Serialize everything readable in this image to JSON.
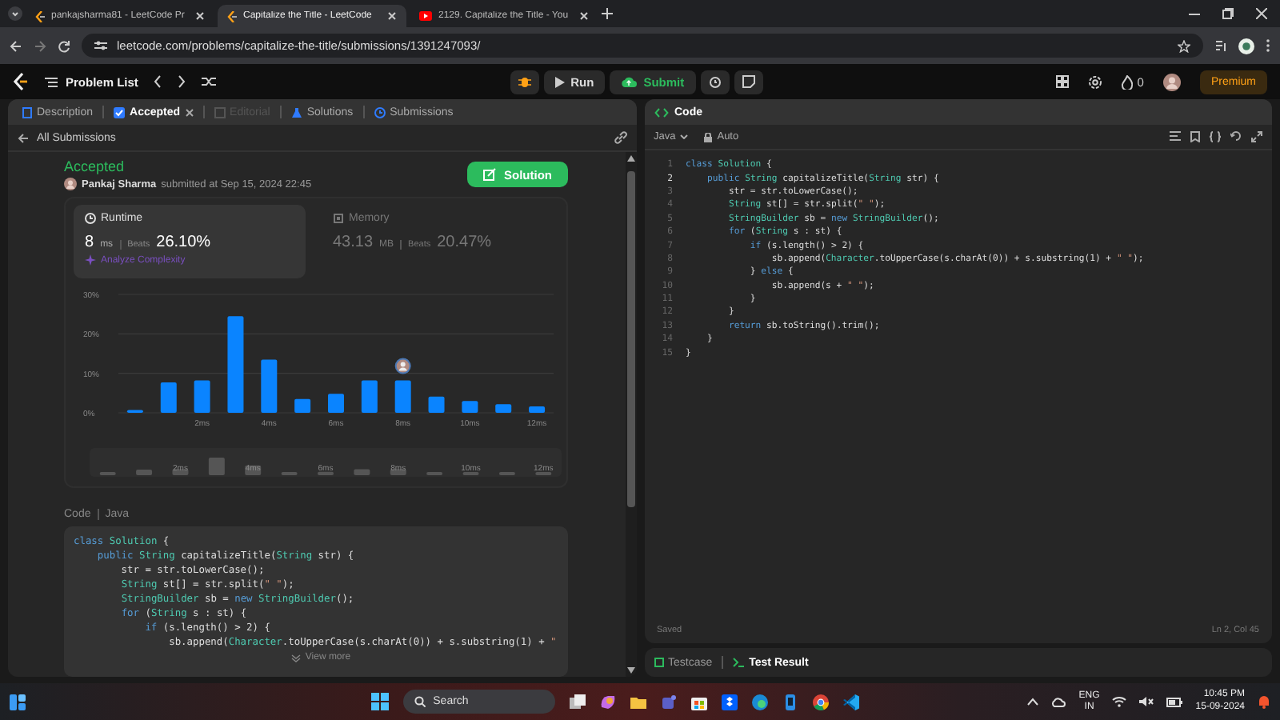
{
  "browser": {
    "tabs": [
      {
        "title": "pankajsharma81 - LeetCode Pr",
        "kind": "leetcode",
        "selected": false
      },
      {
        "title": "Capitalize the Title - LeetCode",
        "kind": "leetcode",
        "selected": true
      },
      {
        "title": "2129. Capitalize the Title - You",
        "kind": "video",
        "selected": false
      }
    ],
    "url": "leetcode.com/problems/capitalize-the-title/submissions/1391247093/"
  },
  "nav": {
    "problem_list": "Problem List",
    "run": "Run",
    "submit": "Submit",
    "streak": "0",
    "premium": "Premium"
  },
  "left_panel": {
    "tabs": [
      {
        "label": "Description",
        "selected": false,
        "disabled": false,
        "closable": false
      },
      {
        "label": "Accepted",
        "selected": true,
        "disabled": false,
        "closable": true
      },
      {
        "label": "Editorial",
        "selected": false,
        "disabled": true,
        "closable": false
      },
      {
        "label": "Solutions",
        "selected": false,
        "disabled": false,
        "closable": false
      },
      {
        "label": "Submissions",
        "selected": false,
        "disabled": false,
        "closable": false
      }
    ],
    "back_link": "All Submissions",
    "status": "Accepted",
    "author": "Pankaj Sharma",
    "submitted": "submitted at Sep 15, 2024 22:45",
    "solution_button": "Solution",
    "metrics": [
      {
        "title": "Runtime",
        "value": "8",
        "unit": "ms",
        "beats_label": "Beats",
        "beats": "26.10%",
        "selected": true,
        "analyze": "Analyze Complexity"
      },
      {
        "title": "Memory",
        "value": "43.13",
        "unit": "MB",
        "beats_label": "Beats",
        "beats": "20.47%",
        "selected": false
      }
    ],
    "chart_data": {
      "type": "bar",
      "x": [
        0,
        1,
        2,
        3,
        4,
        5,
        6,
        7,
        8,
        9,
        10,
        11,
        12
      ],
      "xlim": [
        -0.5,
        12.5
      ],
      "series": [
        {
          "color": "#0a84ff",
          "values": [
            0.7,
            7.7,
            8.2,
            24.5,
            13.5,
            3.5,
            4.8,
            8.2,
            8.2,
            4.1,
            3.0,
            2.2,
            1.6
          ]
        }
      ],
      "ylim": [
        0,
        30
      ],
      "yticks": [
        {
          "value": 0,
          "label": "0%"
        },
        {
          "value": 10,
          "label": "10%"
        },
        {
          "value": 20,
          "label": "20%"
        },
        {
          "value": 30,
          "label": "30%"
        }
      ],
      "xticks": [
        {
          "value": 2,
          "label": "2ms"
        },
        {
          "value": 4,
          "label": "4ms"
        },
        {
          "value": 6,
          "label": "6ms"
        },
        {
          "value": 8,
          "label": "8ms"
        },
        {
          "value": 10,
          "label": "10ms"
        },
        {
          "value": 12,
          "label": "12ms"
        }
      ]
    },
    "overview_labels": [
      "2ms",
      "4ms",
      "6ms",
      "8ms",
      "10ms",
      "12ms"
    ],
    "code_label": "Code",
    "language": "Java",
    "code": [
      "class Solution {",
      "    public String capitalizeTitle(String str) {",
      "        str = str.toLowerCase();",
      "        String st[] = str.split(\" \");",
      "        StringBuilder sb = new StringBuilder();",
      "        for (String s : st) {",
      "            if (s.length() > 2) {",
      "                sb.append(Character.toUpperCase(s.charAt(0)) + s.substring(1) + \""
    ],
    "view_more": "View more"
  },
  "editor": {
    "title": "Code",
    "language": "Java",
    "mode": "Auto",
    "lines": [
      {
        "number": "1",
        "text": "class Solution {",
        "selected": false
      },
      {
        "number": "2",
        "text": "    public String capitalizeTitle(String str) {",
        "selected": true
      },
      {
        "number": "3",
        "text": "        str = str.toLowerCase();",
        "selected": false
      },
      {
        "number": "4",
        "text": "        String st[] = str.split(\" \");",
        "selected": false
      },
      {
        "number": "5",
        "text": "        StringBuilder sb = new StringBuilder();",
        "selected": false
      },
      {
        "number": "6",
        "text": "        for (String s : st) {",
        "selected": false
      },
      {
        "number": "7",
        "text": "            if (s.length() > 2) {",
        "selected": false
      },
      {
        "number": "8",
        "text": "                sb.append(Character.toUpperCase(s.charAt(0)) + s.substring(1) + \" \");",
        "selected": false
      },
      {
        "number": "9",
        "text": "            } else {",
        "selected": false
      },
      {
        "number": "10",
        "text": "                sb.append(s + \" \");",
        "selected": false
      },
      {
        "number": "11",
        "text": "            }",
        "selected": false
      },
      {
        "number": "12",
        "text": "        }",
        "selected": false
      },
      {
        "number": "13",
        "text": "        return sb.toString().trim();",
        "selected": false
      },
      {
        "number": "14",
        "text": "    }",
        "selected": false
      },
      {
        "number": "15",
        "text": "}",
        "selected": false
      }
    ],
    "status": "Saved",
    "cursor": "Ln 2, Col 45",
    "bottom_tabs": [
      {
        "label": "Testcase",
        "selected": false
      },
      {
        "label": "Test Result",
        "selected": true
      }
    ]
  },
  "taskbar": {
    "search": "Search",
    "lang": "ENG",
    "region": "IN",
    "time": "10:45 PM",
    "date": "15-09-2024"
  }
}
